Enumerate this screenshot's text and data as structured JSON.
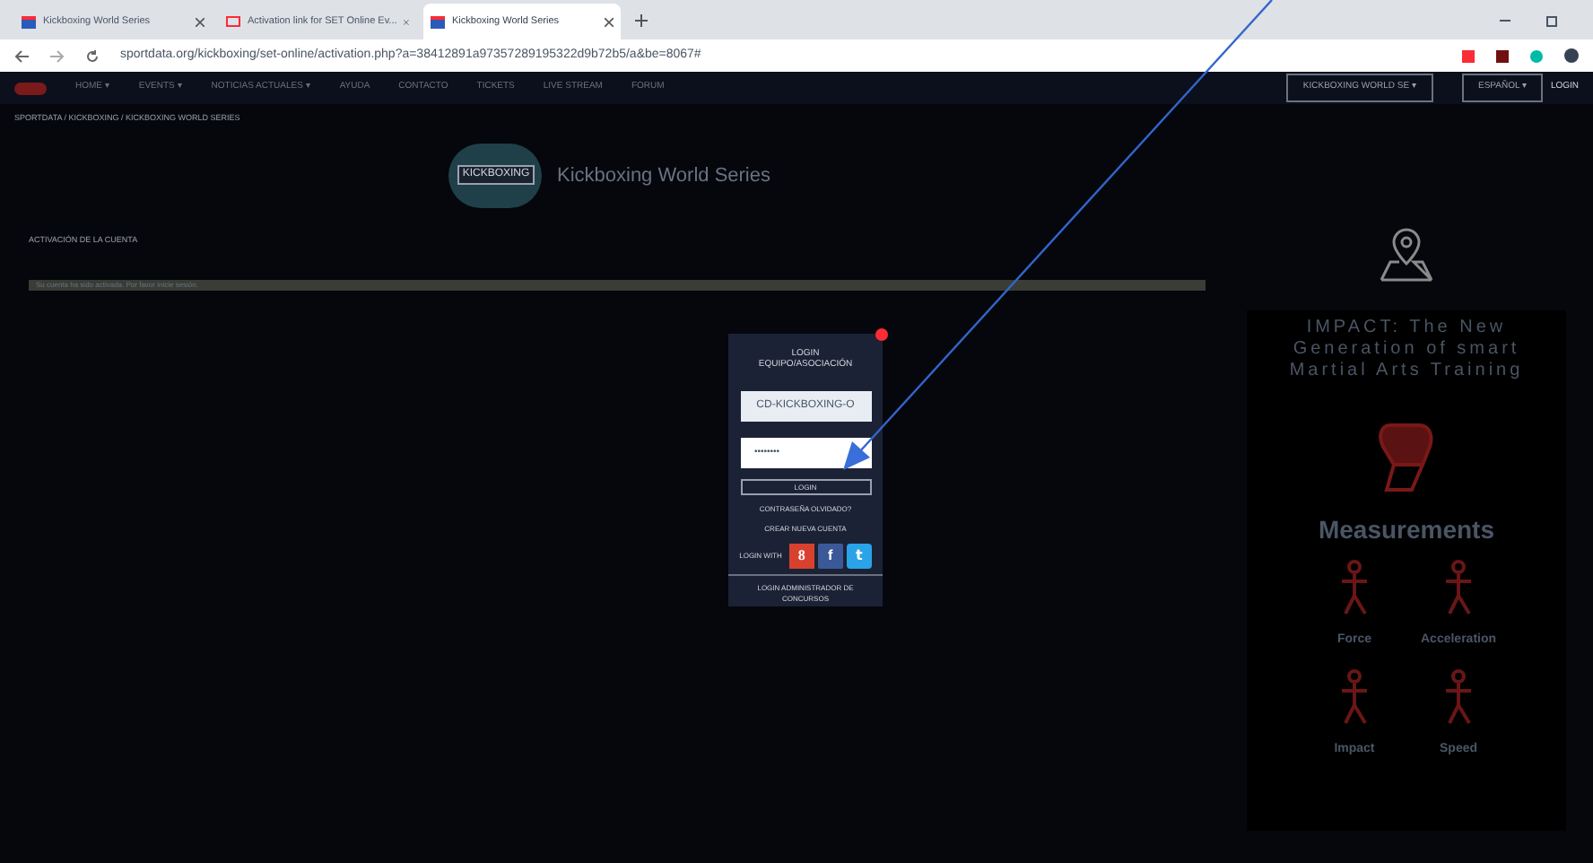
{
  "browser": {
    "tabs": [
      {
        "title": "Kickboxing World Series",
        "selected": false
      },
      {
        "title": "Activation link for SET Online Ev...",
        "selected": false
      },
      {
        "title": "Kickboxing World Series",
        "selected": true
      }
    ],
    "url": "sportdata.org/kickboxing/set-online/activation.php?a=38412891a97357289195322d9b72b5/a&be=8067#"
  },
  "nav": {
    "items": [
      "HOME ▾",
      "EVENTS ▾",
      "NOTICIAS ACTUALES ▾",
      "AYUDA",
      "CONTACTO",
      "TICKETS",
      "LIVE STREAM",
      "FORUM"
    ],
    "selects": [
      "KICKBOXING WORLD SE ▾",
      "ESPAÑOL ▾"
    ],
    "login": "LOGIN"
  },
  "breadcrumb": "SPORTDATA / KICKBOXING / KICKBOXING WORLD SERIES",
  "site_title": "Kickboxing World Series",
  "logo_text": "KICKBOXING",
  "section_title": "ACTIVACIÓN DE LA CUENTA",
  "message": "Su cuenta ha sido activada. Por favor inicie sesión.",
  "login": {
    "title": "LOGIN EQUIPO/ASOCIACIÓN",
    "username": "CD-KICKBOXING-O",
    "password": "••••••••",
    "button": "LOGIN",
    "links": [
      "CONTRASEÑA OLVIDADO?",
      "CREAR NUEVA CUENTA"
    ],
    "social_label": "LOGIN WITH",
    "social": [
      {
        "kind": "google",
        "label": "8",
        "color": "#d9412f"
      },
      {
        "kind": "facebook",
        "label": "f",
        "color": "#3b5998"
      },
      {
        "kind": "twitter",
        "label": "t",
        "color": "#2aa3e8"
      }
    ],
    "admin": "LOGIN ADMINISTRADOR DE CONCURSOS"
  },
  "ad": {
    "headline": "IMPACT: The New Generation of smart Martial Arts Training",
    "subtitle": "Measurements",
    "metrics": [
      "Force",
      "Acceleration",
      "Impact",
      "Speed"
    ]
  }
}
